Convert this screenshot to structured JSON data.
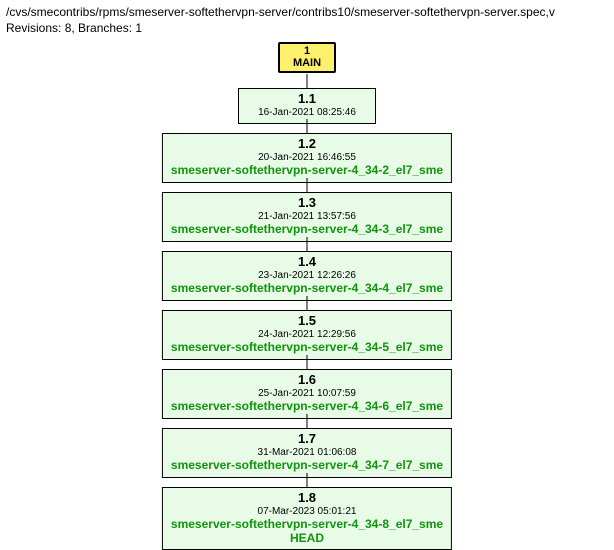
{
  "header": {
    "path": "/cvs/smecontribs/rpms/smeserver-softethervpn-server/contribs10/smeserver-softethervpn-server.spec,v",
    "meta": "Revisions: 8, Branches: 1"
  },
  "branch": {
    "number": "1",
    "name": "MAIN"
  },
  "revisions": [
    {
      "rev": "1.1",
      "date": "16-Jan-2021 08:25:46",
      "tags": []
    },
    {
      "rev": "1.2",
      "date": "20-Jan-2021 16:46:55",
      "tags": [
        "smeserver-softethervpn-server-4_34-2_el7_sme"
      ]
    },
    {
      "rev": "1.3",
      "date": "21-Jan-2021 13:57:56",
      "tags": [
        "smeserver-softethervpn-server-4_34-3_el7_sme"
      ]
    },
    {
      "rev": "1.4",
      "date": "23-Jan-2021 12:26:26",
      "tags": [
        "smeserver-softethervpn-server-4_34-4_el7_sme"
      ]
    },
    {
      "rev": "1.5",
      "date": "24-Jan-2021 12:29:56",
      "tags": [
        "smeserver-softethervpn-server-4_34-5_el7_sme"
      ]
    },
    {
      "rev": "1.6",
      "date": "25-Jan-2021 10:07:59",
      "tags": [
        "smeserver-softethervpn-server-4_34-6_el7_sme"
      ]
    },
    {
      "rev": "1.7",
      "date": "31-Mar-2021 01:06:08",
      "tags": [
        "smeserver-softethervpn-server-4_34-7_el7_sme"
      ]
    },
    {
      "rev": "1.8",
      "date": "07-Mar-2023 05:01:21",
      "tags": [
        "smeserver-softethervpn-server-4_34-8_el7_sme",
        "HEAD"
      ]
    }
  ]
}
